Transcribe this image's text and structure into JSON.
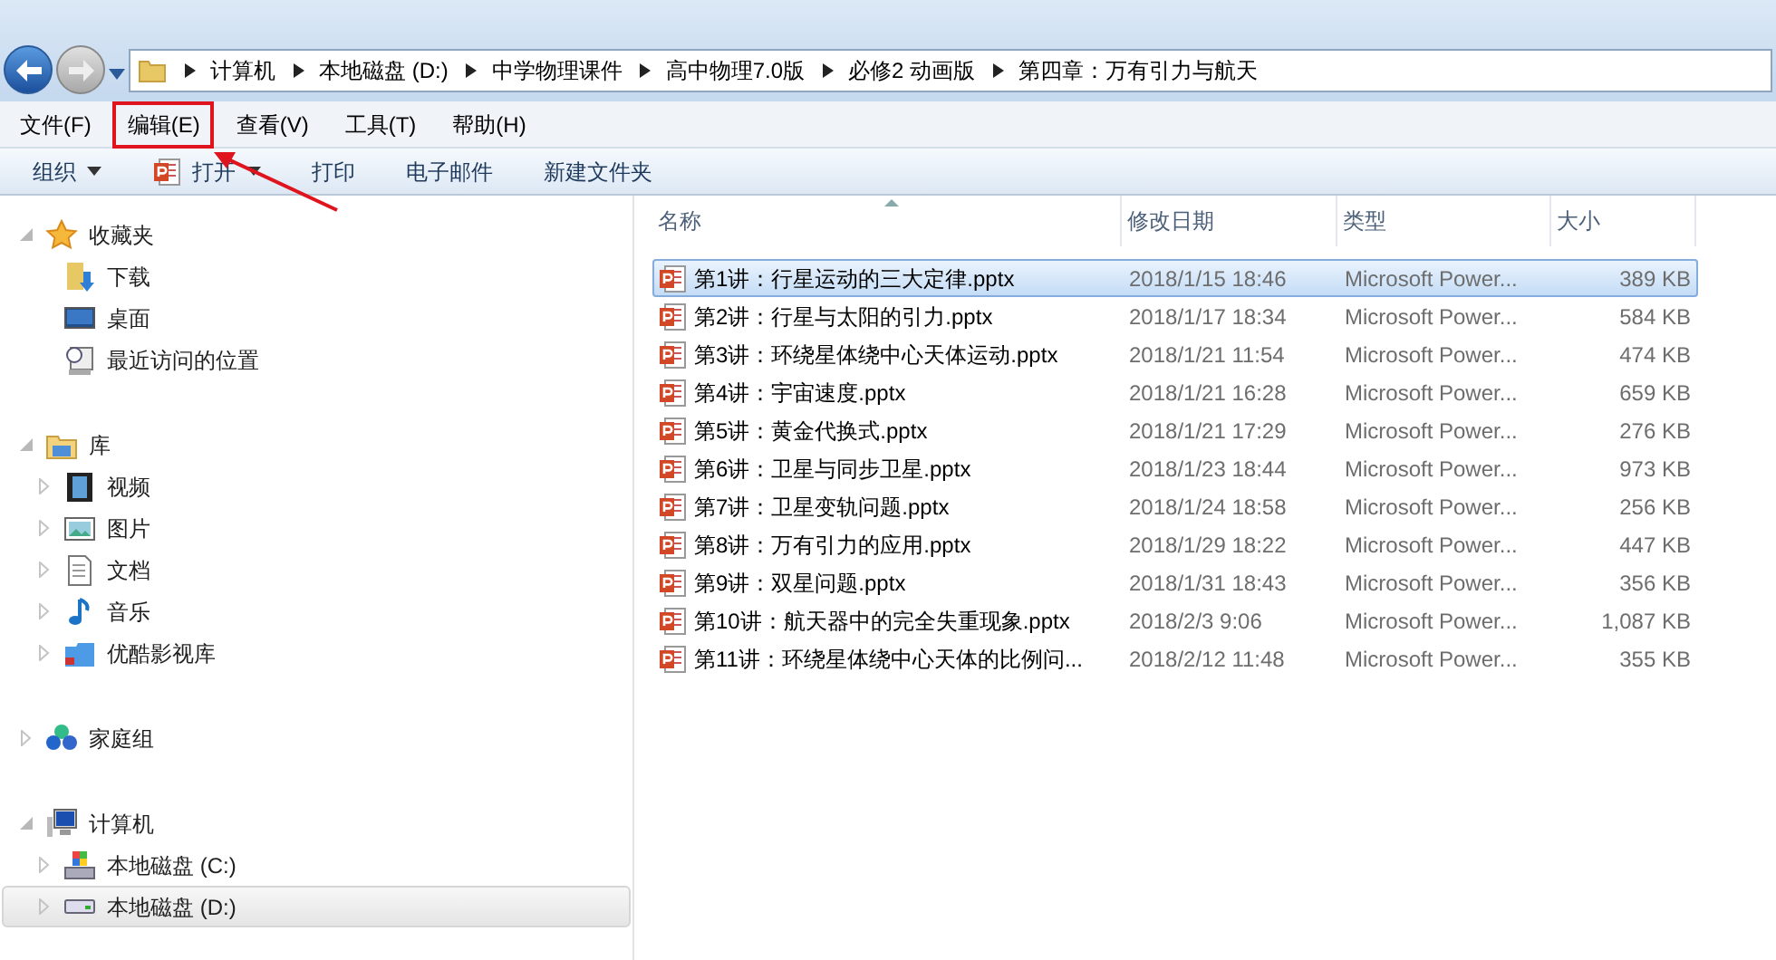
{
  "address_bar": {
    "crumbs": [
      "计算机",
      "本地磁盘 (D:)",
      "中学物理课件",
      "高中物理7.0版",
      "必修2 动画版",
      "第四章：万有引力与航天"
    ]
  },
  "menu_bar": [
    {
      "label": "文件(F)",
      "highlighted": false
    },
    {
      "label": "编辑(E)",
      "highlighted": true
    },
    {
      "label": "查看(V)",
      "highlighted": false
    },
    {
      "label": "工具(T)",
      "highlighted": false
    },
    {
      "label": "帮助(H)",
      "highlighted": false
    }
  ],
  "toolbar": [
    {
      "label": "组织",
      "kind": "dropdown"
    },
    {
      "label": "打开",
      "kind": "open"
    },
    {
      "label": "打印",
      "kind": "plain"
    },
    {
      "label": "电子邮件",
      "kind": "plain"
    },
    {
      "label": "新建文件夹",
      "kind": "plain"
    }
  ],
  "sidebar": {
    "items": [
      {
        "label": "收藏夹",
        "kind": "star",
        "expanded": true,
        "selected": false,
        "children": [
          {
            "label": "下载",
            "kind": "download",
            "selected": false
          },
          {
            "label": "桌面",
            "kind": "desktop",
            "selected": false
          },
          {
            "label": "最近访问的位置",
            "kind": "recent",
            "selected": false
          }
        ]
      },
      {
        "label": "库",
        "kind": "library",
        "expanded": true,
        "selected": false,
        "children": [
          {
            "label": "视频",
            "kind": "video",
            "expanded": false,
            "selected": false
          },
          {
            "label": "图片",
            "kind": "image",
            "expanded": false,
            "selected": false
          },
          {
            "label": "文档",
            "kind": "document",
            "expanded": false,
            "selected": false
          },
          {
            "label": "音乐",
            "kind": "music",
            "expanded": false,
            "selected": false
          },
          {
            "label": "优酷影视库",
            "kind": "folder",
            "expanded": false,
            "selected": false
          }
        ]
      },
      {
        "label": "家庭组",
        "kind": "homegroup",
        "expanded": false,
        "selected": false
      },
      {
        "label": "计算机",
        "kind": "computer",
        "expanded": true,
        "selected": false,
        "children": [
          {
            "label": "本地磁盘 (C:)",
            "kind": "systemdrive",
            "expanded": false,
            "selected": false
          },
          {
            "label": "本地磁盘 (D:)",
            "kind": "drive",
            "expanded": false,
            "selected": true
          }
        ]
      }
    ]
  },
  "table": {
    "columns": [
      "名称",
      "修改日期",
      "类型",
      "大小"
    ],
    "rows": [
      {
        "name": "第1讲：行星运动的三大定律.pptx",
        "date": "2018/1/15 18:46",
        "type": "Microsoft Power...",
        "size": "389 KB",
        "selected": true
      },
      {
        "name": "第2讲：行星与太阳的引力.pptx",
        "date": "2018/1/17 18:34",
        "type": "Microsoft Power...",
        "size": "584 KB",
        "selected": false
      },
      {
        "name": "第3讲：环绕星体绕中心天体运动.pptx",
        "date": "2018/1/21 11:54",
        "type": "Microsoft Power...",
        "size": "474 KB",
        "selected": false
      },
      {
        "name": "第4讲：宇宙速度.pptx",
        "date": "2018/1/21 16:28",
        "type": "Microsoft Power...",
        "size": "659 KB",
        "selected": false
      },
      {
        "name": "第5讲：黄金代换式.pptx",
        "date": "2018/1/21 17:29",
        "type": "Microsoft Power...",
        "size": "276 KB",
        "selected": false
      },
      {
        "name": "第6讲：卫星与同步卫星.pptx",
        "date": "2018/1/23 18:44",
        "type": "Microsoft Power...",
        "size": "973 KB",
        "selected": false
      },
      {
        "name": "第7讲：卫星变轨问题.pptx",
        "date": "2018/1/24 18:58",
        "type": "Microsoft Power...",
        "size": "256 KB",
        "selected": false
      },
      {
        "name": "第8讲：万有引力的应用.pptx",
        "date": "2018/1/29 18:22",
        "type": "Microsoft Power...",
        "size": "447 KB",
        "selected": false
      },
      {
        "name": "第9讲：双星问题.pptx",
        "date": "2018/1/31 18:43",
        "type": "Microsoft Power...",
        "size": "356 KB",
        "selected": false
      },
      {
        "name": "第10讲：航天器中的完全失重现象.pptx",
        "date": "2018/2/3 9:06",
        "type": "Microsoft Power...",
        "size": "1,087 KB",
        "selected": false
      },
      {
        "name": "第11讲：环绕星体绕中心天体的比例问...",
        "date": "2018/2/12 11:48",
        "type": "Microsoft Power...",
        "size": "355 KB",
        "selected": false
      }
    ]
  }
}
